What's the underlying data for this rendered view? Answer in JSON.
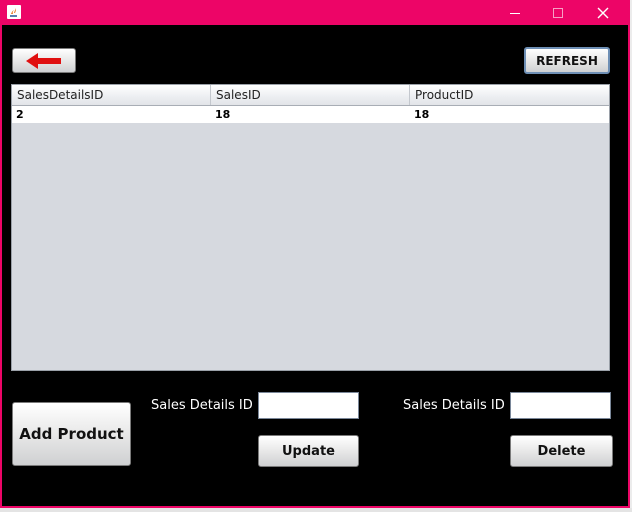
{
  "window": {
    "title": ""
  },
  "toolbar": {
    "back_icon": "red-left-arrow-icon",
    "refresh_label": "REFRESH"
  },
  "table": {
    "columns": [
      "SalesDetailsID",
      "SalesID",
      "ProductID"
    ],
    "rows": [
      [
        "2",
        "18",
        "18"
      ]
    ]
  },
  "form": {
    "add_product_label": "Add Product",
    "update_section": {
      "field_label": "Sales Details ID",
      "field_value": "",
      "button_label": "Update"
    },
    "delete_section": {
      "field_label": "Sales Details ID",
      "field_value": "",
      "button_label": "Delete"
    }
  },
  "colors": {
    "titlebar": "#ed0567",
    "background": "#000000",
    "back_arrow": "#e01010"
  }
}
